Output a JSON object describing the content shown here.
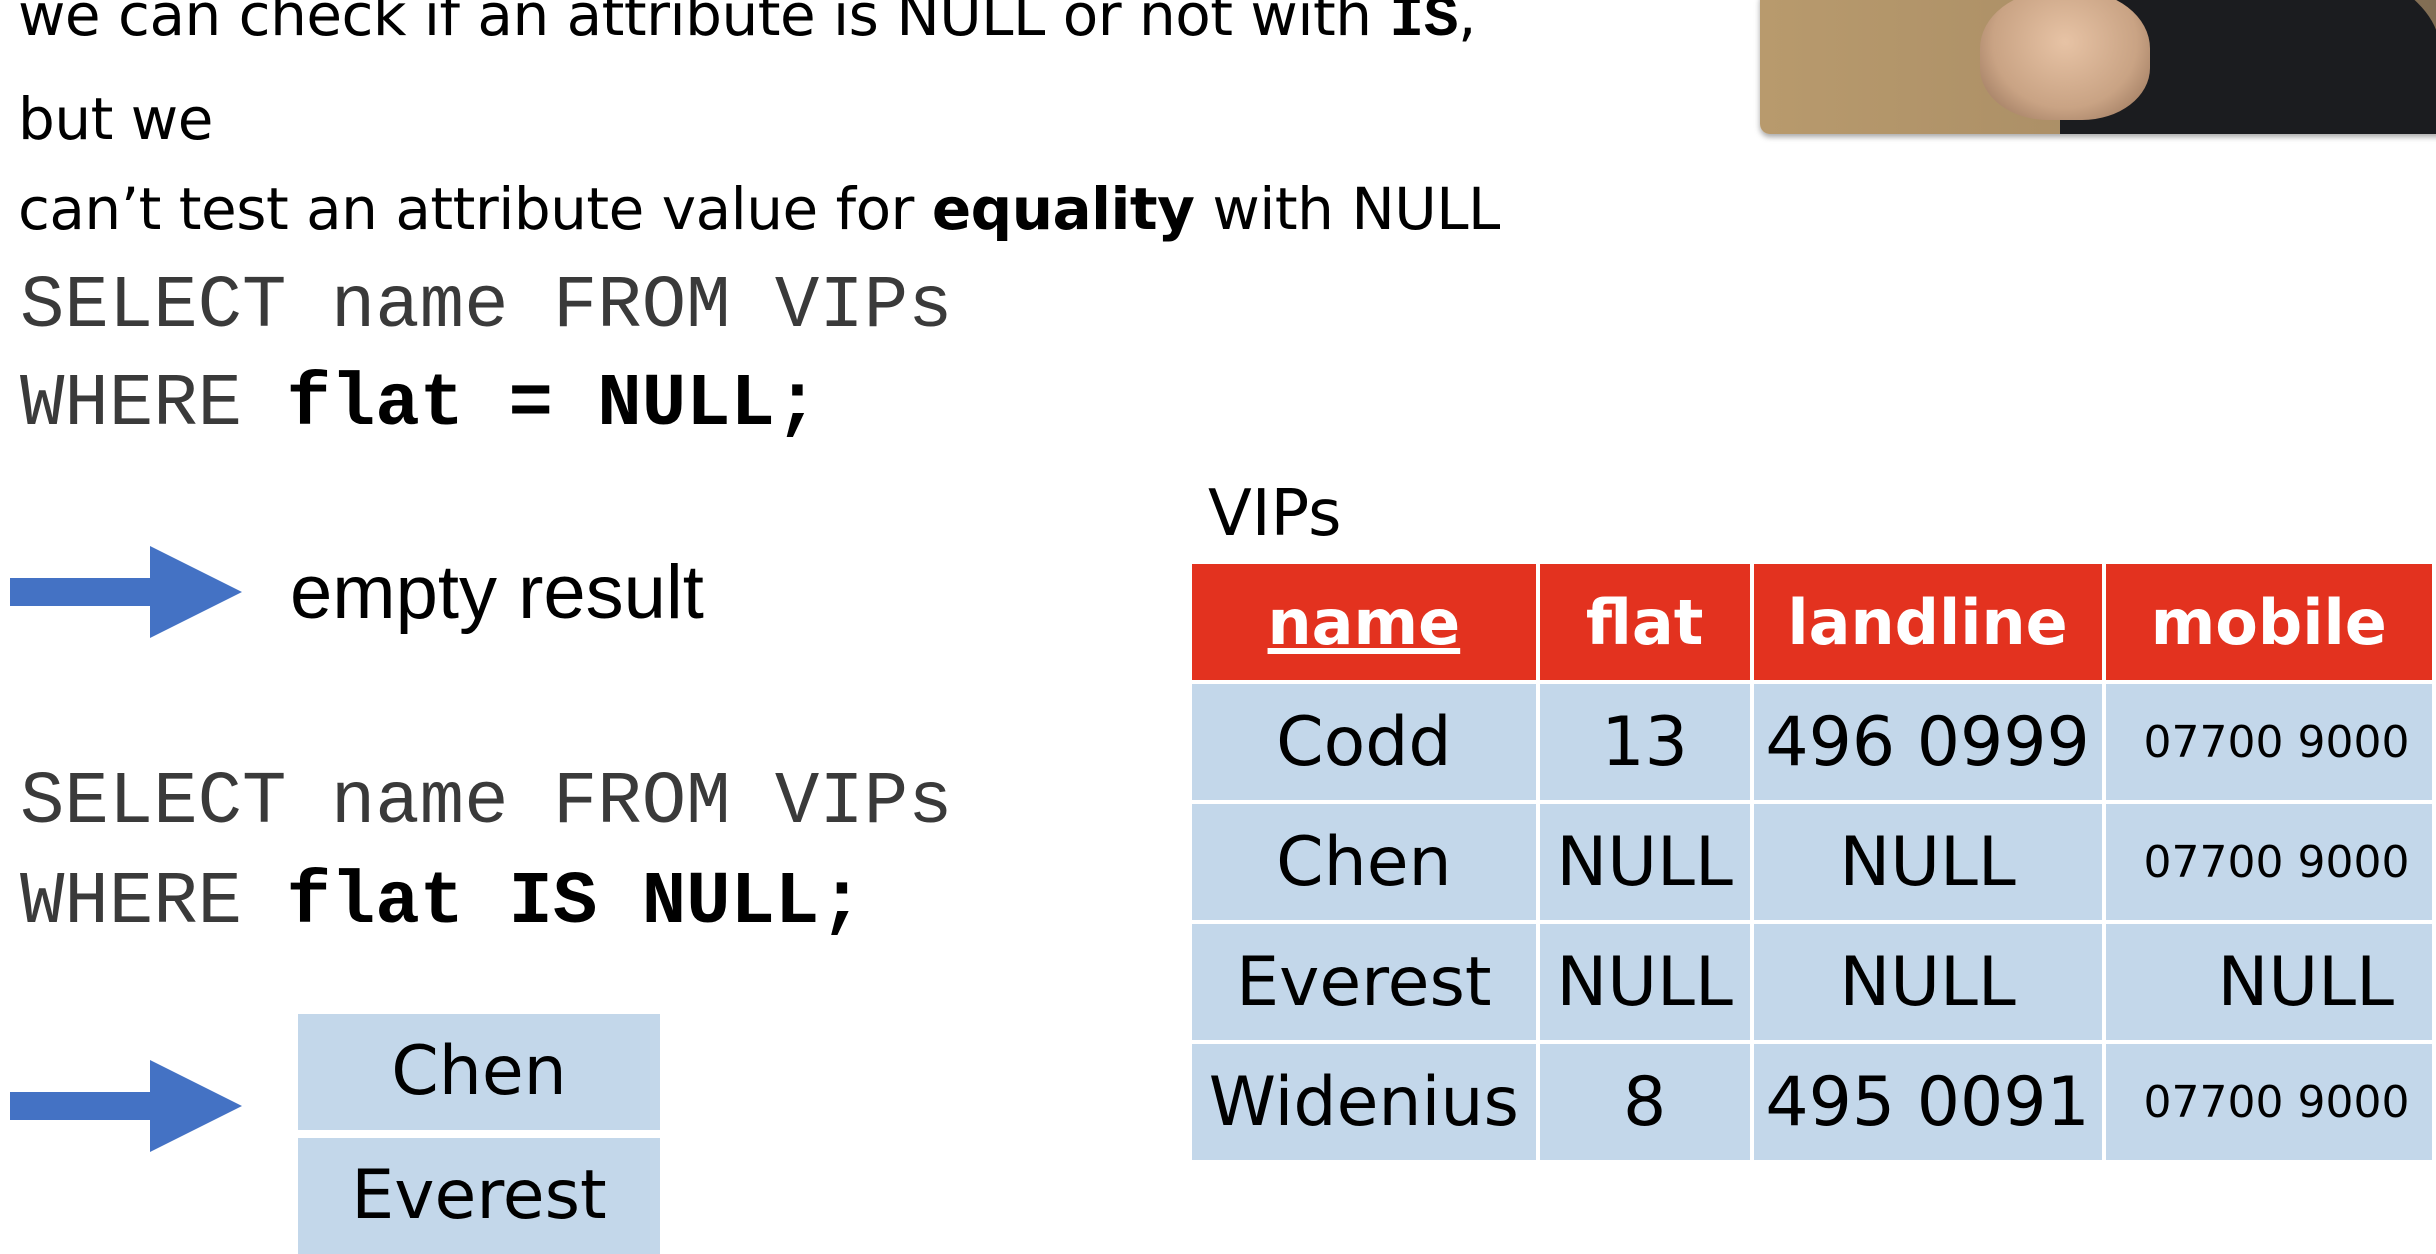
{
  "intro": {
    "line1_text": "we can check if an attribute is NULL or not with ",
    "line1_keyword": "IS",
    "line1_end": ",",
    "line2": "but we",
    "line3_start": "can’t test an attribute value for ",
    "line3_bold": "equality",
    "line3_end": " with NULL"
  },
  "query1": {
    "line1": "SELECT name FROM VIPs",
    "line2_keyword": "WHERE ",
    "line2_bold": "flat = NULL;"
  },
  "result1": "empty result",
  "query2": {
    "line1": "SELECT name FROM VIPs",
    "line2_keyword": "WHERE ",
    "line2_bold": "flat IS NULL;"
  },
  "result2": [
    "Chen",
    "Everest"
  ],
  "vips_table": {
    "title": "VIPs",
    "headers": [
      "name",
      "flat",
      "landline",
      "mobile"
    ],
    "rows": [
      [
        "Codd",
        "13",
        "496 0999",
        "07700 9000"
      ],
      [
        "Chen",
        "NULL",
        "NULL",
        "07700 9000"
      ],
      [
        "Everest",
        "NULL",
        "NULL",
        "NULL"
      ],
      [
        "Widenius",
        "8",
        "495 0091",
        "07700 9000"
      ]
    ]
  },
  "colors": {
    "header_red": "#e3321f",
    "cell_blue": "#c3d7ea",
    "arrow_blue": "#4472c4"
  },
  "icons": [
    "right-arrow-icon",
    "right-arrow-icon"
  ]
}
